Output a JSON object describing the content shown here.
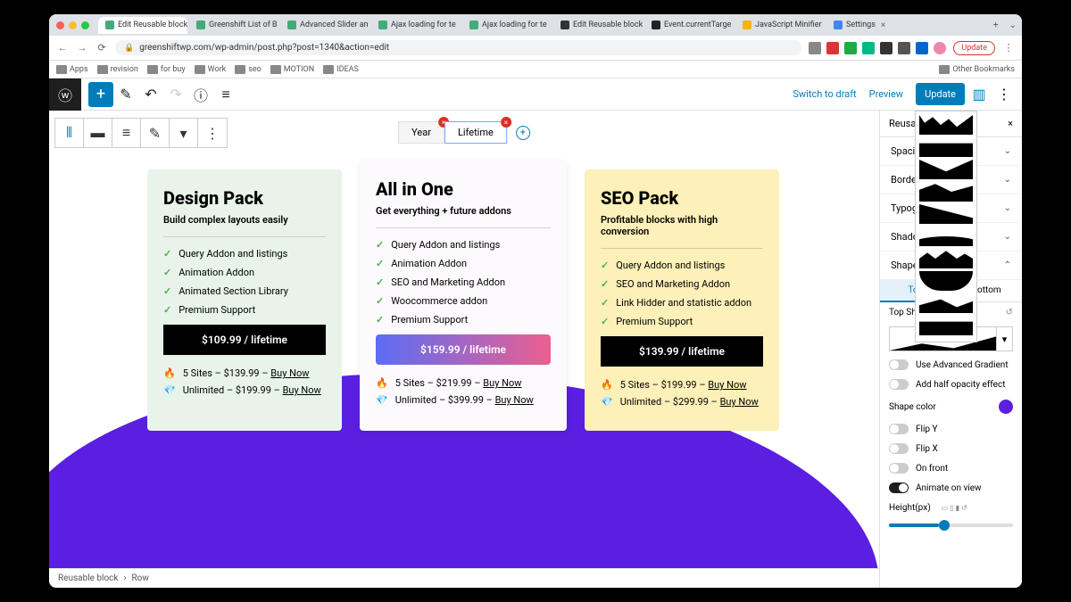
{
  "browser": {
    "tabs": [
      {
        "label": "Edit Reusable block",
        "active": true,
        "fav": "#4a7"
      },
      {
        "label": "Greenshift List of B",
        "fav": "#4a7"
      },
      {
        "label": "Advanced Slider an",
        "fav": "#4a7"
      },
      {
        "label": "Ajax loading for te",
        "fav": "#4a7"
      },
      {
        "label": "Ajax loading for te",
        "fav": "#4a7"
      },
      {
        "label": "Edit Reusable block",
        "fav": "#333"
      },
      {
        "label": "Event.currentTarge",
        "fav": "#222"
      },
      {
        "label": "JavaScript Minifier",
        "fav": "#f7b500"
      },
      {
        "label": "Settings",
        "fav": "#4285f4"
      }
    ],
    "url": "greenshiftwp.com/wp-admin/post.php?post=1340&action=edit",
    "update_label": "Update",
    "bookmarks": [
      "Apps",
      "revision",
      "for buy",
      "Work",
      "seo",
      "MOTION",
      "IDEAS"
    ],
    "other_bookmarks": "Other Bookmarks"
  },
  "wp": {
    "switch_draft": "Switch to draft",
    "preview": "Preview",
    "update": "Update"
  },
  "period": {
    "year": "Year",
    "lifetime": "Lifetime"
  },
  "cards": {
    "design": {
      "title": "Design Pack",
      "sub": "Build complex layouts easily",
      "features": [
        "Query Addon and listings",
        "Animation Addon",
        "Animated Section Library",
        "Premium Support"
      ],
      "price": "$109.99 / lifetime",
      "offers": [
        {
          "icon": "fire",
          "text": "5 Sites – $139.99 – ",
          "link": "Buy Now"
        },
        {
          "icon": "gem",
          "text": "Unlimited – $199.99 – ",
          "link": "Buy Now"
        }
      ]
    },
    "all": {
      "title": "All in One",
      "sub": "Get everything + future addons",
      "features": [
        "Query Addon and listings",
        "Animation Addon",
        "SEO and Marketing Addon",
        "Woocommerce addon",
        "Premium Support"
      ],
      "price": "$159.99 / lifetime",
      "offers": [
        {
          "icon": "fire",
          "text": "5 Sites – $219.99 – ",
          "link": "Buy Now"
        },
        {
          "icon": "gem",
          "text": "Unlimited – $399.99 – ",
          "link": "Buy Now"
        }
      ]
    },
    "seo": {
      "title": "SEO Pack",
      "sub": "Profitable blocks with high conversion",
      "features": [
        "Query Addon and listings",
        "SEO and Marketing Addon",
        "Link Hidder and statistic addon",
        "Premium Support"
      ],
      "price": "$139.99 / lifetime",
      "offers": [
        {
          "icon": "fire",
          "text": "5 Sites – $199.99 – ",
          "link": "Buy Now"
        },
        {
          "icon": "gem",
          "text": "Unlimited – $299.99 – ",
          "link": "Buy Now"
        }
      ]
    }
  },
  "sidebar": {
    "tab": "Reusable",
    "panels": [
      "Spacing",
      "Border",
      "Typography",
      "Shadow",
      "Shape Divider"
    ],
    "subtabs": {
      "top": "Top",
      "bottom": "Bottom"
    },
    "top_shape": "Top Shape",
    "toggles": {
      "adv_grad": "Use Advanced Gradient",
      "half_opacity": "Add half opacity effect",
      "flip_y": "Flip Y",
      "flip_x": "Flip X",
      "on_front": "On front",
      "animate": "Animate on view"
    },
    "shape_color": "Shape color",
    "height": "Height(px)"
  },
  "crumb": {
    "a": "Reusable block",
    "b": "Row"
  }
}
